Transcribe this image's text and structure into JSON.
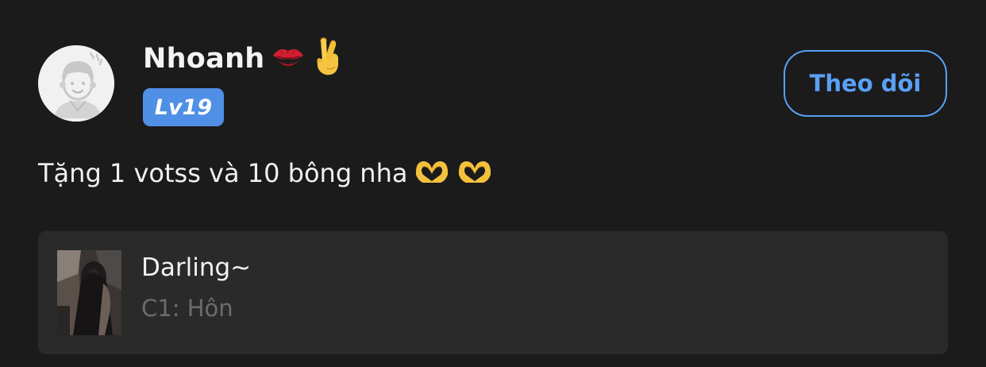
{
  "user": {
    "name": "Nhoanh",
    "level": "Lv19",
    "name_emojis": [
      "kiss-mark-icon",
      "crossed-fingers-icon"
    ]
  },
  "follow_button": {
    "label": "Theo dõi"
  },
  "post": {
    "text": "Tặng 1 votss và 10 bông nha",
    "trailing_emojis": [
      "heart-hands-icon",
      "heart-hands-icon"
    ]
  },
  "song_card": {
    "title": "Darling~",
    "subtitle": "C1: Hôn"
  },
  "colors": {
    "background": "#1b1b1c",
    "card": "#2a2a2b",
    "accent": "#5aa0f5",
    "badge": "#4f8fe6",
    "muted_text": "#6c6c6e"
  }
}
